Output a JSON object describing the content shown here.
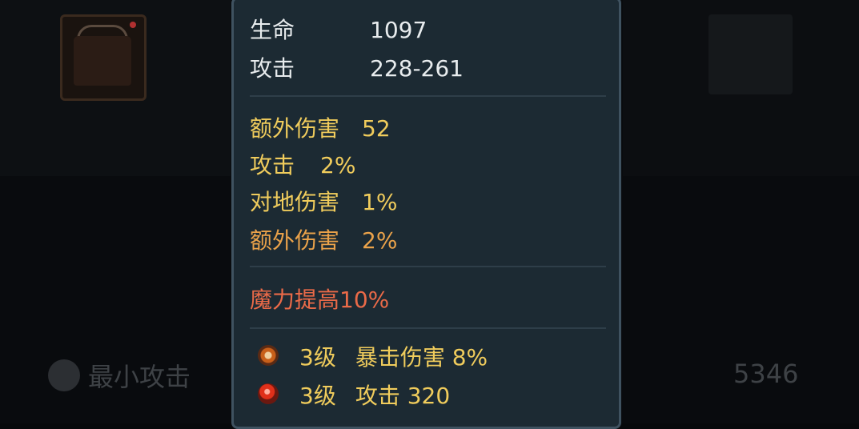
{
  "background": {
    "stat_label": "最小攻击",
    "stat_value": "5346"
  },
  "tooltip": {
    "base_stats": [
      {
        "label": "生命",
        "value": "1097"
      },
      {
        "label": "攻击",
        "value": "228-261"
      }
    ],
    "bonus_stats": [
      {
        "label": "额外伤害",
        "value": "52",
        "color": "#f0cc5c"
      },
      {
        "label": "攻击",
        "value": "2%",
        "color": "#f0cc5c"
      },
      {
        "label": "对地伤害",
        "value": "1%",
        "color": "#f0cc5c"
      },
      {
        "label": "额外伤害",
        "value": "2%",
        "color": "#eaa24a"
      }
    ],
    "special": {
      "text": "魔力提高10%",
      "color": "#ea6a48"
    },
    "gems": [
      {
        "icon": "orange-gem-icon",
        "level": "3级",
        "effect": "暴击伤害 8%"
      },
      {
        "icon": "red-gem-icon",
        "level": "3级",
        "effect": "攻击 320"
      }
    ]
  }
}
